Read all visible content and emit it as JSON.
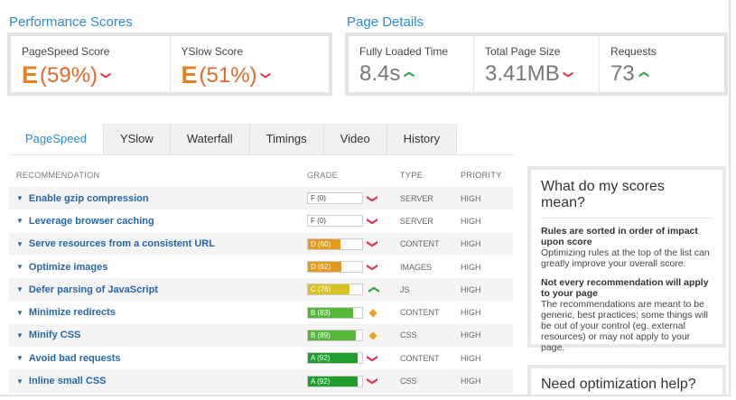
{
  "sections": {
    "performance_title": "Performance Scores",
    "details_title": "Page Details"
  },
  "scores": {
    "pagespeed": {
      "label": "PageSpeed Score",
      "grade": "E",
      "value": "(59%)",
      "trend": "down"
    },
    "yslow": {
      "label": "YSlow Score",
      "grade": "E",
      "value": "(51%)",
      "trend": "down"
    }
  },
  "details": {
    "loaded": {
      "label": "Fully Loaded Time",
      "value": "8.4s",
      "trend": "up"
    },
    "size": {
      "label": "Total Page Size",
      "value": "3.41MB",
      "trend": "down"
    },
    "requests": {
      "label": "Requests",
      "value": "73",
      "trend": "up"
    }
  },
  "tabs": [
    {
      "label": "PageSpeed",
      "active": true
    },
    {
      "label": "YSlow",
      "active": false
    },
    {
      "label": "Waterfall",
      "active": false
    },
    {
      "label": "Timings",
      "active": false
    },
    {
      "label": "Video",
      "active": false
    },
    {
      "label": "History",
      "active": false
    }
  ],
  "table": {
    "headers": {
      "recommendation": "RECOMMENDATION",
      "grade": "GRADE",
      "type": "TYPE",
      "priority": "PRIORITY"
    },
    "rows": [
      {
        "name": "Enable gzip compression",
        "grade": "F (0)",
        "score": 0,
        "color": "#e8e8e8",
        "icon": "down",
        "type": "SERVER",
        "priority": "HIGH"
      },
      {
        "name": "Leverage browser caching",
        "grade": "F (0)",
        "score": 0,
        "color": "#e8e8e8",
        "icon": "down",
        "type": "SERVER",
        "priority": "HIGH"
      },
      {
        "name": "Serve resources from a consistent URL",
        "grade": "D (60)",
        "score": 60,
        "color": "#e59a1c",
        "icon": "down",
        "type": "CONTENT",
        "priority": "HIGH"
      },
      {
        "name": "Optimize images",
        "grade": "D (62)",
        "score": 62,
        "color": "#e59a1c",
        "icon": "down",
        "type": "IMAGES",
        "priority": "HIGH"
      },
      {
        "name": "Defer parsing of JavaScript",
        "grade": "C (76)",
        "score": 76,
        "color": "#d6c222",
        "icon": "up",
        "type": "JS",
        "priority": "HIGH"
      },
      {
        "name": "Minimize redirects",
        "grade": "B (83)",
        "score": 83,
        "color": "#55b83a",
        "icon": "diamond",
        "type": "CONTENT",
        "priority": "HIGH"
      },
      {
        "name": "Minify CSS",
        "grade": "B (89)",
        "score": 89,
        "color": "#55b83a",
        "icon": "diamond",
        "type": "CSS",
        "priority": "HIGH"
      },
      {
        "name": "Avoid bad requests",
        "grade": "A (92)",
        "score": 92,
        "color": "#1f9e2e",
        "icon": "down",
        "type": "CONTENT",
        "priority": "HIGH"
      },
      {
        "name": "Inline small CSS",
        "grade": "A (92)",
        "score": 92,
        "color": "#1f9e2e",
        "icon": "down",
        "type": "CSS",
        "priority": "HIGH"
      }
    ]
  },
  "panel": {
    "title": "What do my scores mean?",
    "p1_bold": "Rules are sorted in order of impact upon score",
    "p1_text": "Optimizing rules at the top of the list can greatly improve your overall score.",
    "p2_bold": "Not every recommendation will apply to your page",
    "p2_text": "The recommendations are meant to be generic, best practices; some things will be out of your control (eg. external resources) or may not apply to your page."
  },
  "panel2": {
    "title": "Need optimization help?"
  },
  "colors": {
    "accent": "#2a8cd3",
    "grade_e": "#e67e22",
    "down": "#d9364f",
    "up": "#2ea44a",
    "diamond": "#f0a020",
    "link": "#2467a8"
  }
}
